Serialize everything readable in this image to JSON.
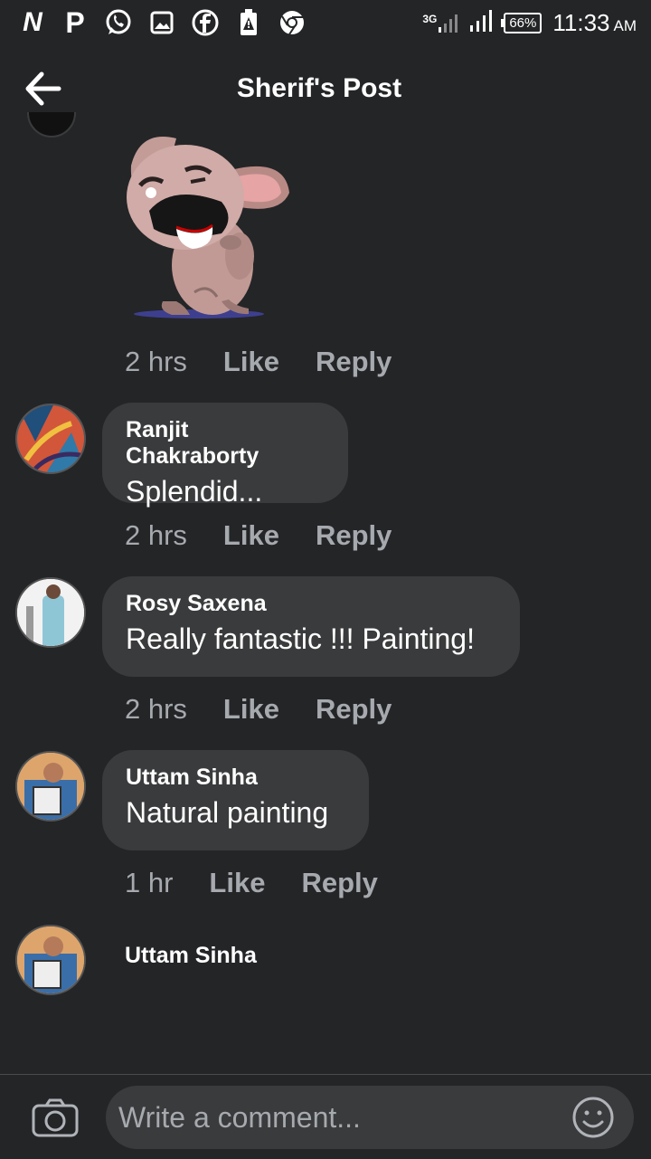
{
  "status_bar": {
    "network": "3G",
    "battery": "66%",
    "time": "11:33",
    "ampm": "AM",
    "icons": [
      "netflix-icon",
      "pinterest-icon",
      "whatsapp-icon",
      "gallery-icon",
      "facebook-icon",
      "battery-alert-icon",
      "chrome-icon"
    ]
  },
  "header": {
    "title": "Sherif's Post"
  },
  "sticker_comment": {
    "time": "2 hrs",
    "like": "Like",
    "reply": "Reply"
  },
  "comments": [
    {
      "name": "Ranjit Chakraborty",
      "text": "Splendid...",
      "time": "2 hrs",
      "like": "Like",
      "reply": "Reply"
    },
    {
      "name": "Rosy Saxena",
      "text": "Really fantastic !!! Painting!",
      "time": "2 hrs",
      "like": "Like",
      "reply": "Reply"
    },
    {
      "name": "Uttam Sinha",
      "text": "Natural painting",
      "time": "1 hr",
      "like": "Like",
      "reply": "Reply"
    },
    {
      "name": "Uttam Sinha"
    }
  ],
  "composer": {
    "placeholder": "Write a comment..."
  },
  "colors": {
    "background": "#242527",
    "bubble": "#3a3b3c",
    "muted_text": "#a6a9ae"
  }
}
